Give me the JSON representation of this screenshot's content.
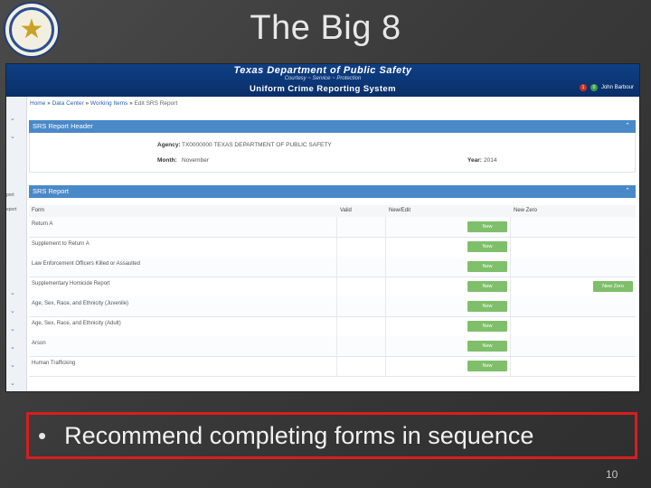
{
  "slide": {
    "title": "The Big 8",
    "caption": "Recommend completing forms in sequence",
    "bullet": "•",
    "page_number": "10"
  },
  "banner": {
    "agency": "Texas Department of Public Safety",
    "motto": "Courtesy ~ Service ~ Protection",
    "system": "Uniform Crime Reporting System",
    "alert_count": "1",
    "notice_count": "0",
    "user": "John Barbour"
  },
  "breadcrumb": {
    "home": "Home",
    "data_center": "Data Center",
    "working_items": "Working Items",
    "current": "Edit SRS Report",
    "sep": "»"
  },
  "sidebar": {
    "label1": "port",
    "label2": "eport"
  },
  "header_panel": {
    "title": "SRS Report Header",
    "agency_label": "Agency:",
    "agency_value": "TX0000000 TEXAS DEPARTMENT OF PUBLIC SAFETY",
    "month_label": "Month:",
    "month_value": "November",
    "year_label": "Year:",
    "year_value": "2014"
  },
  "report_panel": {
    "title": "SRS Report",
    "columns": {
      "form": "Form",
      "valid": "Valid",
      "new_edit": "New/Edit",
      "new_zero": "New Zero"
    },
    "new_label": "New",
    "new_zero_label": "New Zero",
    "rows": [
      {
        "form": "Return A"
      },
      {
        "form": "Supplement to Return A"
      },
      {
        "form": "Law Enforcement Officers Killed or Assaulted"
      },
      {
        "form": "Supplementary Homicide Report"
      },
      {
        "form": "Age, Sex, Race, and Ethnicity (Juvenile)"
      },
      {
        "form": "Age, Sex, Race, and Ethnicity (Adult)"
      },
      {
        "form": "Arson"
      },
      {
        "form": "Human Trafficking"
      }
    ]
  },
  "colors": {
    "banner": "#0f3f86",
    "panel_header": "#4a89c8",
    "new_button": "#7fbf6a",
    "caption_border": "#d81e1e"
  },
  "icons": [
    "star-seal-icon",
    "chevron-up-icon",
    "chevron-down-icon",
    "alert-badge-icon",
    "notice-badge-icon"
  ]
}
